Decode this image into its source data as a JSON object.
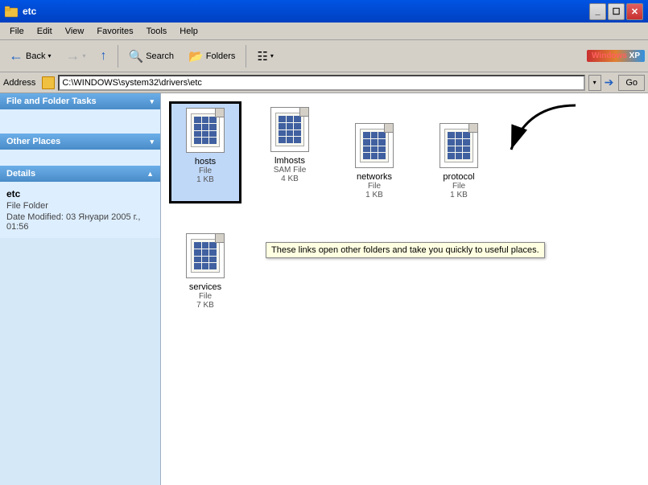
{
  "window": {
    "title": "etc",
    "icon": "folder-icon"
  },
  "menu": {
    "items": [
      "File",
      "Edit",
      "View",
      "Favorites",
      "Tools",
      "Help"
    ]
  },
  "toolbar": {
    "back_label": "Back",
    "search_label": "Search",
    "folders_label": "Folders",
    "views_dropdown": "▾"
  },
  "address": {
    "label": "Address",
    "path": "C:\\WINDOWS\\system32\\drivers\\etc",
    "go_label": "Go"
  },
  "left_panel": {
    "file_folder_tasks": {
      "header": "File and Folder Tasks",
      "links": []
    },
    "other_places": {
      "header": "Other Places",
      "tooltip": "These links open other folders and take you quickly to useful places.",
      "links": []
    },
    "details": {
      "header": "Details",
      "name": "etc",
      "type": "File Folder",
      "date_modified": "Date Modified: 03 Януари 2005 г., 01:56"
    }
  },
  "files": [
    {
      "name": "hosts",
      "type": "File",
      "size": "1 KB",
      "selected": true
    },
    {
      "name": "lmhosts",
      "type": "SAM File",
      "size": "4 KB",
      "selected": false
    },
    {
      "name": "networks",
      "type": "File",
      "size": "1 KB",
      "selected": false
    },
    {
      "name": "protocol",
      "type": "File",
      "size": "1 KB",
      "selected": false
    },
    {
      "name": "services",
      "type": "File",
      "size": "7 KB",
      "selected": false
    }
  ],
  "tooltip": {
    "text": "These links open other folders and take you quickly to useful places."
  }
}
